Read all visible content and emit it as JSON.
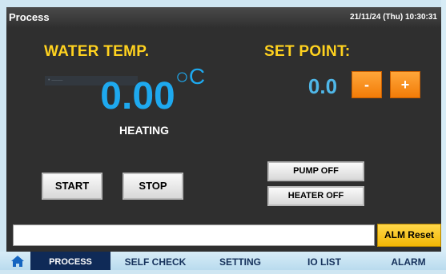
{
  "header": {
    "title": "Process",
    "datetime": "21/11/24 (Thu) 10:30:31"
  },
  "water_temp": {
    "label": "WATER TEMP.",
    "value": "0.00",
    "unit": "○C",
    "status": "HEATING",
    "faded_text": "• ——"
  },
  "set_point": {
    "label": "SET POINT:",
    "value": "0.0",
    "decrease_label": "-",
    "increase_label": "+"
  },
  "buttons": {
    "start": "START",
    "stop": "STOP",
    "pump_off": "PUMP OFF",
    "heater_off": "HEATER OFF",
    "alarm_reset": "ALM Reset"
  },
  "alarm_message": "",
  "nav": {
    "home_icon": "home-icon",
    "tabs": [
      "PROCESS",
      "SELF CHECK",
      "SETTING",
      "IO LIST",
      "ALARM"
    ],
    "active": "PROCESS"
  },
  "colors": {
    "header_bg": "#3a3a3a",
    "panel_bg": "#2f2f2f",
    "label_yellow": "#ffd21f",
    "value_blue": "#1ea9ef",
    "orange_button": "#f5891a",
    "alarm_button": "#f2b705",
    "nav_active": "#0f2a57"
  }
}
